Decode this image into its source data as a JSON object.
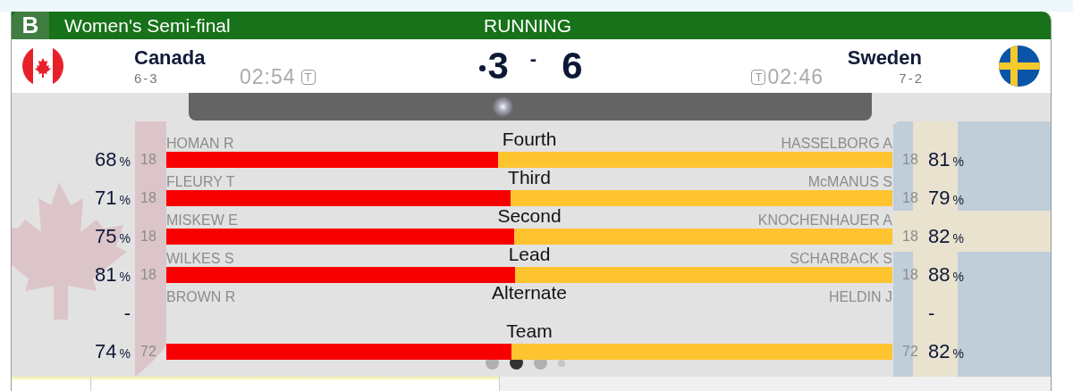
{
  "header": {
    "group": "B",
    "title": "Women's Semi-final",
    "status": "RUNNING"
  },
  "home": {
    "team": "Canada",
    "record": "6-3",
    "time": "02:54",
    "timer_icon": "T",
    "score": "3",
    "hammer": true,
    "kind": "canada"
  },
  "score_separator": "-",
  "away": {
    "team": "Sweden",
    "record": "7-2",
    "time": "02:46",
    "timer_icon": "T",
    "score": "6",
    "hammer": false,
    "kind": "sweden"
  },
  "rows": [
    {
      "position": "Fourth",
      "level": 0.457,
      "home": {
        "name": "HOMAN R",
        "shots": "18",
        "pct": "68",
        "unit": "%"
      },
      "away": {
        "name": "HASSELBORG A",
        "shots": "18",
        "pct": "81",
        "unit": "%"
      }
    },
    {
      "position": "Third",
      "level": 0.474,
      "home": {
        "name": "FLEURY T",
        "shots": "18",
        "pct": "71",
        "unit": "%"
      },
      "away": {
        "name": "McMANUS S",
        "shots": "18",
        "pct": "79",
        "unit": "%"
      }
    },
    {
      "position": "Second",
      "level": 0.479,
      "home": {
        "name": "MISKEW E",
        "shots": "18",
        "pct": "75",
        "unit": "%"
      },
      "away": {
        "name": "KNOCHENHAUER A",
        "shots": "18",
        "pct": "82",
        "unit": "%"
      }
    },
    {
      "position": "Lead",
      "level": 0.48,
      "home": {
        "name": "WILKES S",
        "shots": "18",
        "pct": "81",
        "unit": "%"
      },
      "away": {
        "name": "SCHARBACK S",
        "shots": "18",
        "pct": "88",
        "unit": "%"
      }
    },
    {
      "position": "Alternate",
      "home": {
        "name": "BROWN R",
        "pct": "-"
      },
      "away": {
        "name": "HELDIN J",
        "pct": "-"
      }
    },
    {
      "position": "Team",
      "level": 0.475,
      "home": {
        "shots": "72",
        "pct": "74",
        "unit": "%"
      },
      "away": {
        "shots": "72",
        "pct": "82",
        "unit": "%"
      }
    }
  ],
  "pages": [
    {
      "kind": "dot",
      "selected": false
    },
    {
      "kind": "dot",
      "selected": true
    },
    {
      "kind": "dot",
      "selected": false
    },
    {
      "kind": "more",
      "selected": false
    }
  ]
}
